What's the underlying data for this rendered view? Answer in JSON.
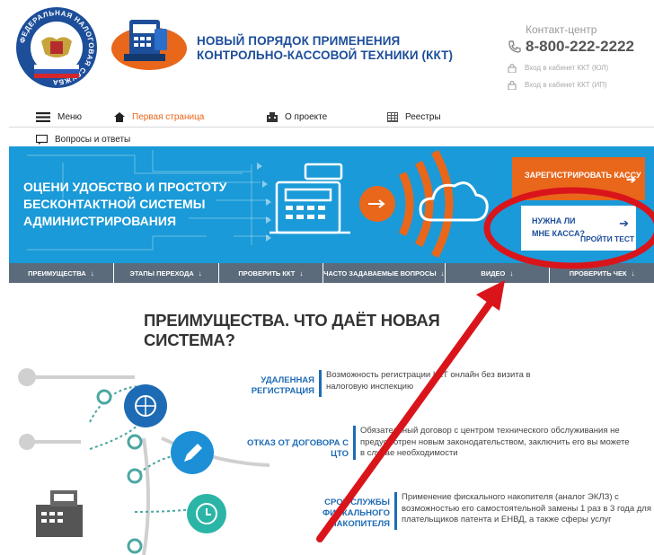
{
  "header": {
    "emblem_text": "ФЕДЕРАЛЬНАЯ НАЛОГОВАЯ СЛУЖБА",
    "site_title": "НОВЫЙ ПОРЯДОК ПРИМЕНЕНИЯ КОНТРОЛЬНО-КАССОВОЙ ТЕХНИКИ (ККТ)",
    "contact_label": "Контакт-центр",
    "phone": "8-800-222-2222",
    "cabinet_ul": "Вход в кабинет ККТ (ЮЛ)",
    "cabinet_ip": "Вход в кабинет ККТ (ИП)"
  },
  "nav": {
    "menu": "Меню",
    "home": "Первая страница",
    "about": "О проекте",
    "registries": "Реестры",
    "faq": "Вопросы и ответы"
  },
  "banner": {
    "headline": "ОЦЕНИ УДОБСТВО И ПРОСТОТУ БЕСКОНТАКТНОЙ СИСТЕМЫ АДМИНИСТРИРОВАНИЯ",
    "register_label": "ЗАРЕГИСТРИРОВАТЬ КАССУ",
    "test_question": "НУЖНА ЛИ МНЕ КАССА?",
    "test_link": "ПРОЙТИ ТЕСТ"
  },
  "tabs": [
    {
      "label": "ПРЕИМУЩЕСТВА"
    },
    {
      "label": "ЭТАПЫ ПЕРЕХОДА"
    },
    {
      "label": "ПРОВЕРИТЬ ККТ"
    },
    {
      "label": "ЧАСТО ЗАДАВАЕМЫЕ ВОПРОСЫ"
    },
    {
      "label": "ВИДЕО"
    },
    {
      "label": "ПРОВЕРИТЬ ЧЕК"
    }
  ],
  "advantages": {
    "title": "ПРЕИМУЩЕСТВА. ЧТО ДАЁТ НОВАЯ СИСТЕМА?",
    "items": [
      {
        "name": "УДАЛЕННАЯ РЕГИСТРАЦИЯ",
        "desc": "Возможность регистрации ККТ онлайн без визита в налоговую инспекцию"
      },
      {
        "name": "ОТКАЗ ОТ ДОГОВОРА С ЦТО",
        "desc": "Обязательный договор с центром технического обслуживания не предусмотрен новым законодательством, заключить его вы можете в случае необходимости"
      },
      {
        "name": "СРОК СЛУЖБЫ ФИСКАЛЬНОГО НАКОПИТЕЛЯ",
        "desc": "Применение фискального накопителя (аналог ЭКЛЗ) с возможностью его самостоятельной замены 1 раз в 3 года для плательщиков патента и ЕНВД, а также сферы услуг"
      }
    ]
  },
  "colors": {
    "brand_blue": "#1d4e9a",
    "banner_blue": "#1a9ad8",
    "accent_orange": "#e8671b",
    "tab_gray": "#5b6b7b",
    "annotation_red": "#d9151b"
  }
}
